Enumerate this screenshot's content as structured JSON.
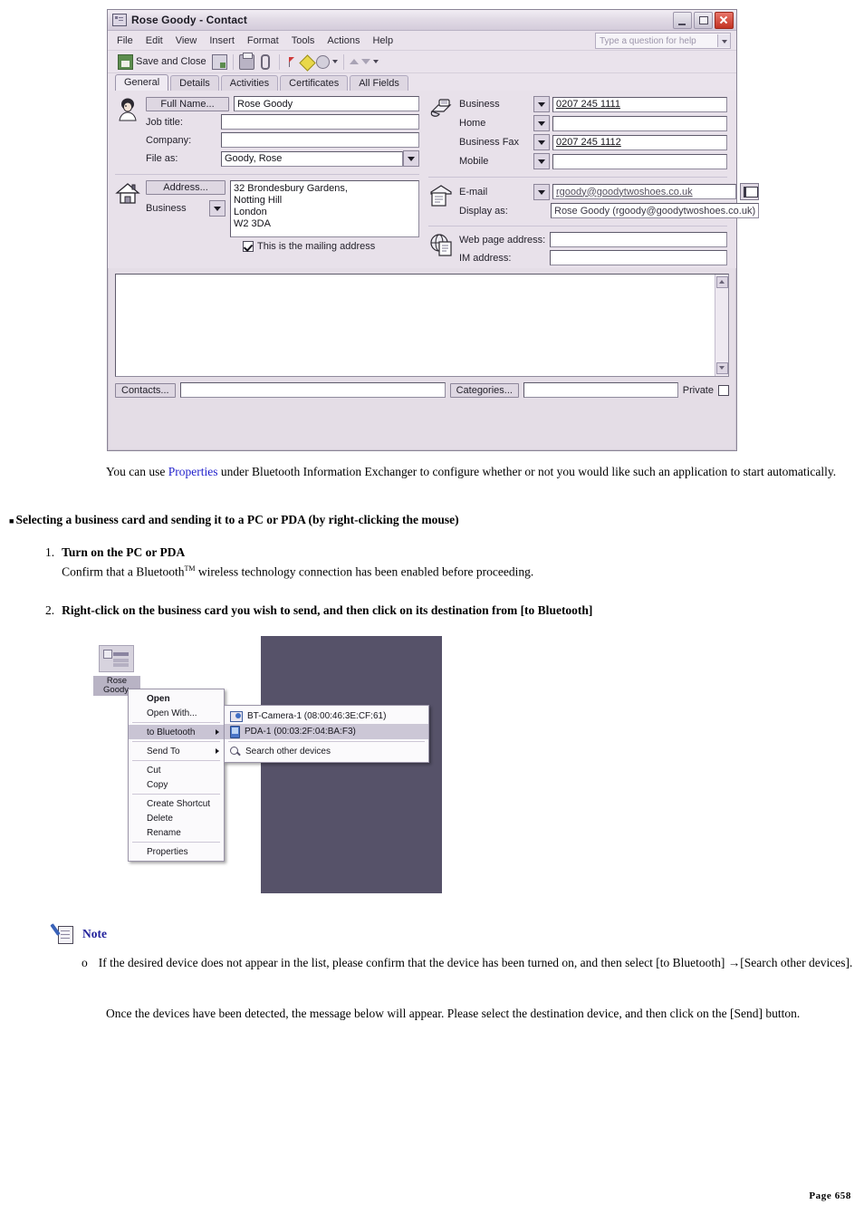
{
  "contact_window": {
    "title": "Rose Goody - Contact",
    "window_buttons": [
      "minimize",
      "maximize",
      "close"
    ],
    "menus": [
      "File",
      "Edit",
      "View",
      "Insert",
      "Format",
      "Tools",
      "Actions",
      "Help"
    ],
    "help_placeholder": "Type a question for help",
    "toolbar": {
      "save_and_close": "Save and Close"
    },
    "tabs": [
      {
        "label": "General",
        "active": true
      },
      {
        "label": "Details",
        "active": false
      },
      {
        "label": "Activities",
        "active": false
      },
      {
        "label": "Certificates",
        "active": false
      },
      {
        "label": "All Fields",
        "active": false
      }
    ],
    "name_section": {
      "full_name_button": "Full Name...",
      "full_name_value": "Rose Goody",
      "job_title_label": "Job title:",
      "job_title_value": "",
      "company_label": "Company:",
      "company_value": "",
      "file_as_label": "File as:",
      "file_as_value": "Goody, Rose"
    },
    "phones": [
      {
        "label": "Business",
        "value": "0207 245 1111"
      },
      {
        "label": "Home",
        "value": ""
      },
      {
        "label": "Business Fax",
        "value": "0207 245 1112"
      },
      {
        "label": "Mobile",
        "value": ""
      }
    ],
    "address_section": {
      "address_button": "Address...",
      "address_type": "Business",
      "address_value": "32  Brondesbury Gardens,\nNotting Hill\nLondon\nW2 3DA",
      "mailing_checkbox_label": "This is the mailing address",
      "mailing_checked": true
    },
    "email_section": {
      "email_label": "E-mail",
      "email_value": "rgoody@goodytwoshoes.co.uk",
      "display_as_label": "Display as:",
      "display_as_value": "Rose Goody (rgoody@goodytwoshoes.co.uk)"
    },
    "web_section": {
      "web_label": "Web page address:",
      "web_value": "",
      "im_label": "IM address:",
      "im_value": ""
    },
    "notes_value": "",
    "footer": {
      "contacts_button": "Contacts...",
      "contacts_value": "",
      "categories_button": "Categories...",
      "categories_value": "",
      "private_label": "Private",
      "private_checked": false
    }
  },
  "body": {
    "intro_pre": "You can use ",
    "intro_link": "Properties",
    "intro_post": " under Bluetooth Information Exchanger to configure whether or not you would like such an application to start automatically.",
    "section_heading": "Selecting a business card and sending it to a PC or PDA (by right-clicking the mouse)",
    "steps": [
      {
        "num": "1.",
        "title": "Turn on the PC or PDA",
        "detail_pre": "Confirm that a Bluetooth",
        "detail_sup": "TM",
        "detail_post": " wireless technology connection has been enabled before proceeding."
      },
      {
        "num": "2.",
        "title": "Right-click on the business card you wish to send, and then click on its destination from [to Bluetooth]",
        "detail_pre": "",
        "detail_sup": "",
        "detail_post": ""
      }
    ]
  },
  "screenshot": {
    "desktop_icon_label": "Rose\nGoody.",
    "context_menu": [
      {
        "label": "Open",
        "bold": true,
        "submenu": false,
        "selected": false
      },
      {
        "label": "Open With...",
        "bold": false,
        "submenu": false,
        "selected": false
      },
      {
        "separator": true
      },
      {
        "label": "to Bluetooth",
        "bold": false,
        "submenu": true,
        "selected": true
      },
      {
        "separator": true
      },
      {
        "label": "Send To",
        "bold": false,
        "submenu": true,
        "selected": false
      },
      {
        "separator": true
      },
      {
        "label": "Cut",
        "bold": false,
        "submenu": false,
        "selected": false
      },
      {
        "label": "Copy",
        "bold": false,
        "submenu": false,
        "selected": false
      },
      {
        "separator": true
      },
      {
        "label": "Create Shortcut",
        "bold": false,
        "submenu": false,
        "selected": false
      },
      {
        "label": "Delete",
        "bold": false,
        "submenu": false,
        "selected": false
      },
      {
        "label": "Rename",
        "bold": false,
        "submenu": false,
        "selected": false
      },
      {
        "separator": true
      },
      {
        "label": "Properties",
        "bold": false,
        "submenu": false,
        "selected": false
      }
    ],
    "submenu": [
      {
        "label": "BT-Camera-1 (08:00:46:3E:CF:61)",
        "icon": "camera-icon",
        "selected": false
      },
      {
        "label": "PDA-1 (00:03:2F:04:BA:F3)",
        "icon": "pda-icon",
        "selected": true
      },
      {
        "separator": true
      },
      {
        "label": "Search other devices",
        "icon": "search-icon",
        "selected": false
      }
    ]
  },
  "note": {
    "title": "Note",
    "bullet_marker": "o",
    "bullet_text": "If the desired device does not appear in the list, please confirm that the device has been turned on, and then select [to Bluetooth] →[Search other devices].",
    "paragraph": "Once the devices have been detected, the message below will appear. Please select the destination device, and then click on the [Send] button."
  },
  "page_footer": "Page 658",
  "colors": {
    "accent_link": "#2222cc",
    "pane_bg": "#565269",
    "form_bg": "#e8e1ea"
  }
}
